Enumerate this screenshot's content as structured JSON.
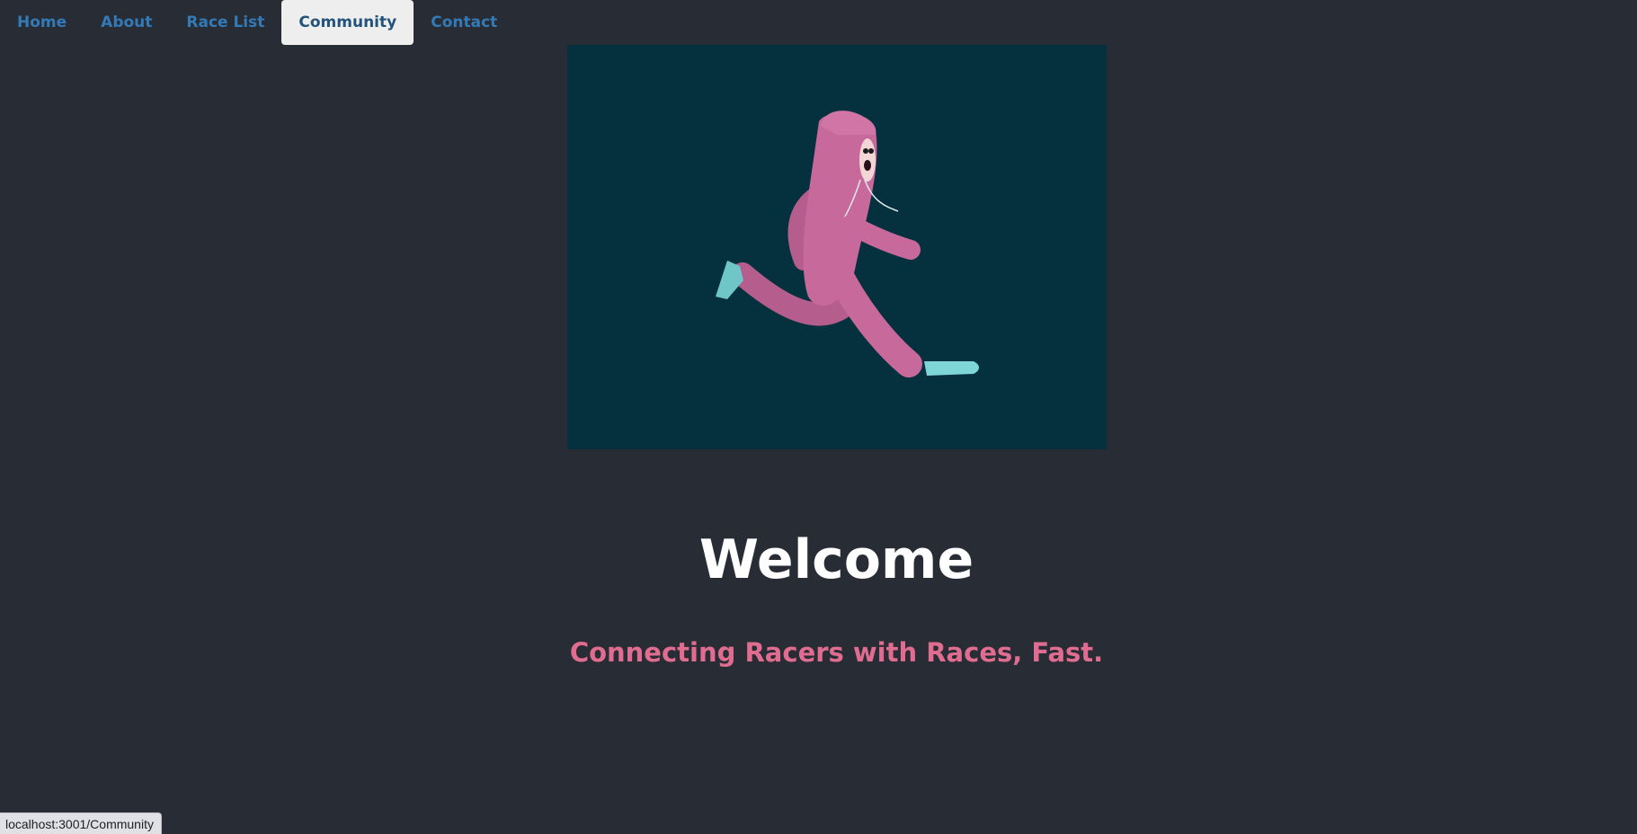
{
  "nav": {
    "items": [
      {
        "label": "Home",
        "active": false
      },
      {
        "label": "About",
        "active": false
      },
      {
        "label": "Race List",
        "active": false
      },
      {
        "label": "Community",
        "active": true
      },
      {
        "label": "Contact",
        "active": false
      }
    ]
  },
  "hero": {
    "image": "running-character-illustration",
    "background_color": "#05303e",
    "character_color": "#c8699b",
    "shoe_color": "#7fd6d6"
  },
  "main": {
    "title": "Welcome",
    "tagline": "Connecting Racers with Races, Fast."
  },
  "colors": {
    "page_background": "#282c34",
    "nav_link": "#337ab7",
    "tagline": "#e06c8f"
  },
  "status_bar": {
    "url": "localhost:3001/Community"
  }
}
